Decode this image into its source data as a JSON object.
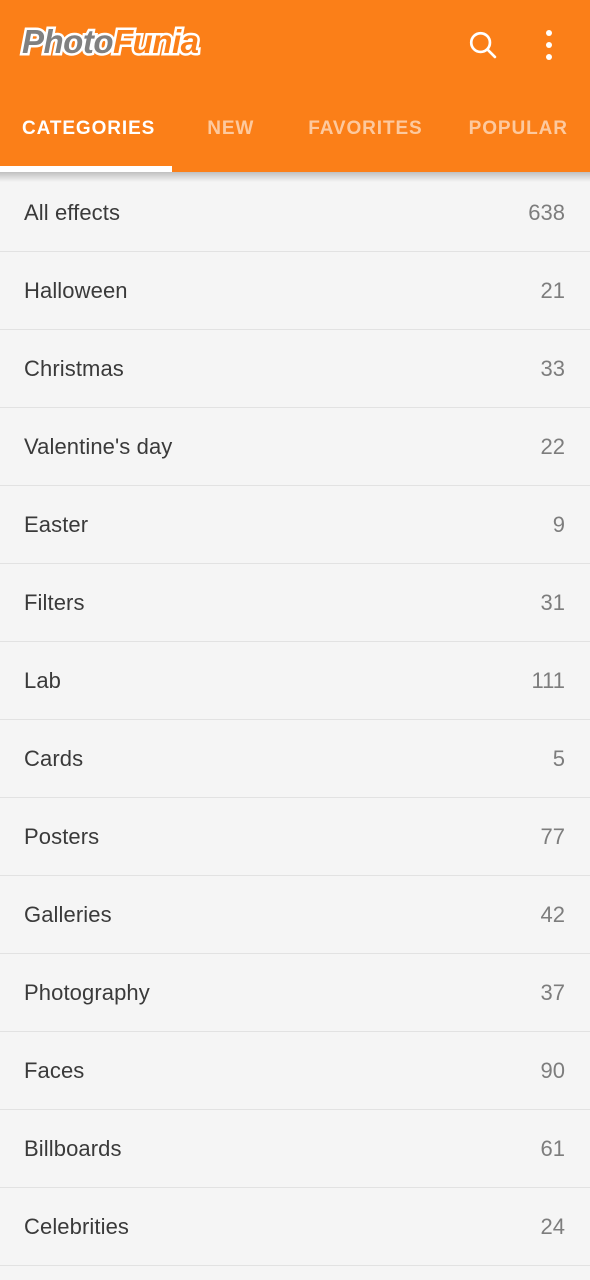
{
  "app": {
    "logo_primary": "Photo",
    "logo_secondary": "Funia",
    "accent_color": "#FB7F18",
    "logo_primary_color": "#808080",
    "logo_secondary_color": "#FB7F18",
    "list_bg_color": "#F5F5F5",
    "label_color": "#3A3A3A",
    "count_color": "#7D7D7D",
    "divider_color": "#E2E2E2"
  },
  "header": {
    "search_icon": "search-icon",
    "overflow_icon": "more-vertical-icon"
  },
  "tabs": [
    {
      "label": "CATEGORIES",
      "active": true
    },
    {
      "label": "NEW",
      "active": false
    },
    {
      "label": "FAVORITES",
      "active": false
    },
    {
      "label": "POPULAR",
      "active": false
    }
  ],
  "categories": [
    {
      "name": "All effects",
      "count": "638"
    },
    {
      "name": "Halloween",
      "count": "21"
    },
    {
      "name": "Christmas",
      "count": "33"
    },
    {
      "name": "Valentine's day",
      "count": "22"
    },
    {
      "name": "Easter",
      "count": "9"
    },
    {
      "name": "Filters",
      "count": "31"
    },
    {
      "name": "Lab",
      "count": "111"
    },
    {
      "name": "Cards",
      "count": "5"
    },
    {
      "name": "Posters",
      "count": "77"
    },
    {
      "name": "Galleries",
      "count": "42"
    },
    {
      "name": "Photography",
      "count": "37"
    },
    {
      "name": "Faces",
      "count": "90"
    },
    {
      "name": "Billboards",
      "count": "61"
    },
    {
      "name": "Celebrities",
      "count": "24"
    }
  ]
}
